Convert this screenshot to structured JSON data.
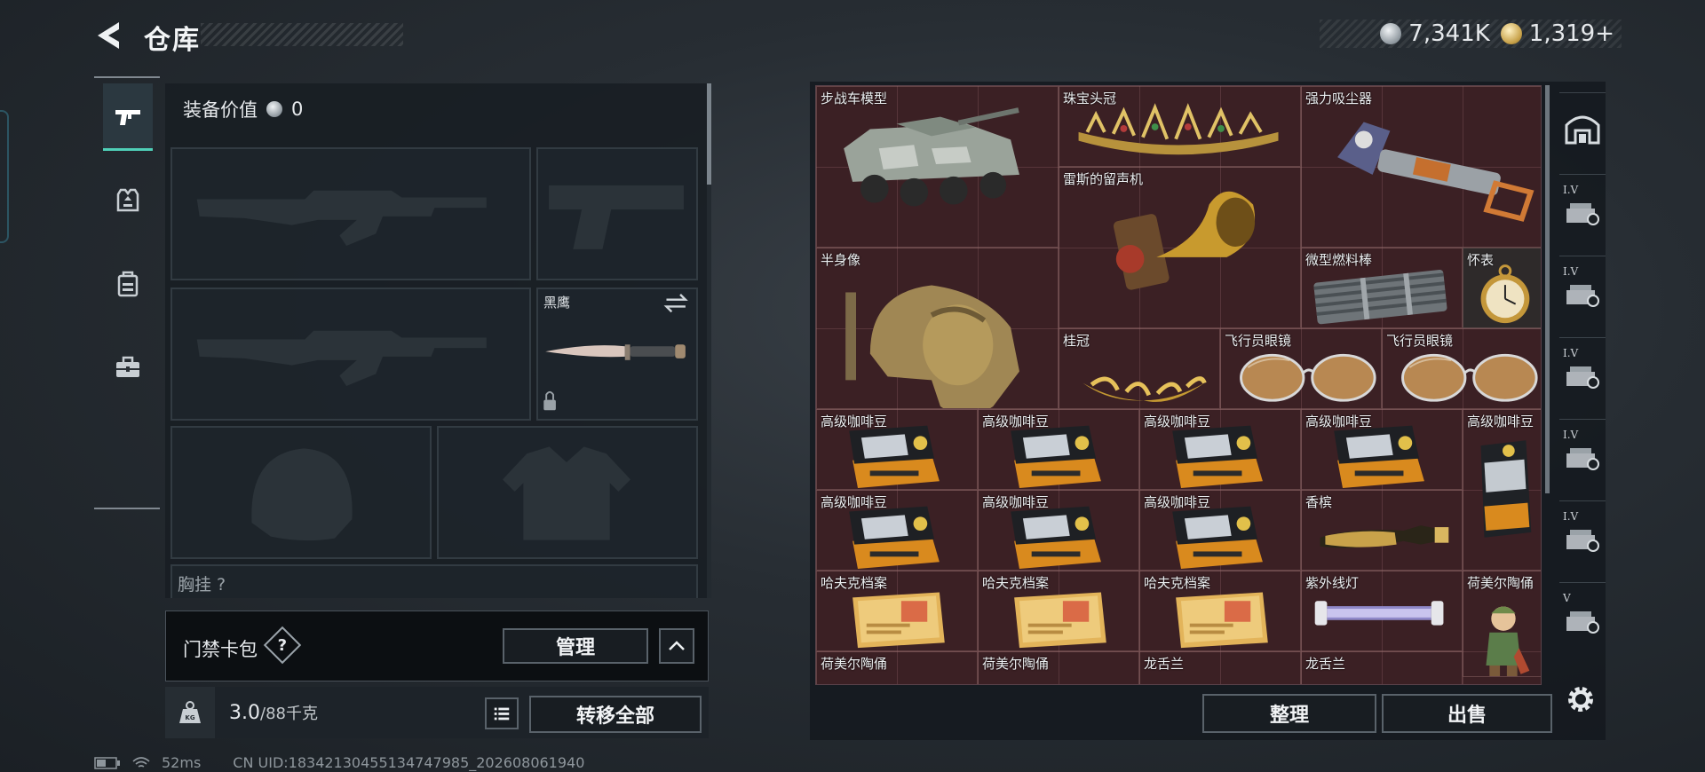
{
  "header": {
    "title": "仓库",
    "currency": [
      {
        "icon": "silver-coin-icon",
        "value": "7,341K"
      },
      {
        "icon": "gold-coin-icon",
        "value": "1,319+"
      }
    ]
  },
  "left_rail": {
    "tabs": [
      {
        "name": "weapons",
        "icon": "pistol-icon",
        "active": true
      },
      {
        "name": "armor",
        "icon": "armor-icon",
        "active": false
      },
      {
        "name": "backpack",
        "icon": "backpack-icon",
        "active": false
      },
      {
        "name": "toolbox",
        "icon": "toolbox-icon",
        "active": false
      }
    ]
  },
  "equipment": {
    "value_label": "装备价值",
    "value": "0",
    "melee_name": "黑鹰",
    "partial_label": "胸挂 ?",
    "slots": [
      "primary-weapon-1",
      "sidearm",
      "primary-weapon-2",
      "melee",
      "helmet",
      "body-armor"
    ]
  },
  "card_pack": {
    "label": "门禁卡包",
    "help": "?",
    "manage_label": "管理"
  },
  "weight": {
    "icon_text": "KG",
    "current": "3.0",
    "max": "/88千克",
    "transfer_label": "转移全部"
  },
  "stash": {
    "items": [
      {
        "name": "步战车模型",
        "img": "ifv"
      },
      {
        "name": "珠宝头冠",
        "img": "tiara"
      },
      {
        "name": "强力吸尘器",
        "img": "vacuum"
      },
      {
        "name": "雷斯的留声机",
        "img": "gramophone"
      },
      {
        "name": "半身像",
        "img": "bust"
      },
      {
        "name": "微型燃料棒",
        "img": "fuelrods"
      },
      {
        "name": "怀表",
        "img": "watch"
      },
      {
        "name": "桂冠",
        "img": "laurel"
      },
      {
        "name": "飞行员眼镜",
        "img": "glasses"
      },
      {
        "name": "飞行员眼镜",
        "img": "glasses"
      },
      {
        "name": "高级咖啡豆",
        "img": "coffee"
      },
      {
        "name": "高级咖啡豆",
        "img": "coffee"
      },
      {
        "name": "高级咖啡豆",
        "img": "coffee"
      },
      {
        "name": "高级咖啡豆",
        "img": "coffee"
      },
      {
        "name": "高级咖啡豆",
        "img": "coffee_tall"
      },
      {
        "name": "高级咖啡豆",
        "img": "coffee"
      },
      {
        "name": "高级咖啡豆",
        "img": "coffee"
      },
      {
        "name": "高级咖啡豆",
        "img": "coffee"
      },
      {
        "name": "香槟",
        "img": "champagne"
      },
      {
        "name": "哈夫克档案",
        "img": "files"
      },
      {
        "name": "哈夫克档案",
        "img": "files"
      },
      {
        "name": "哈夫克档案",
        "img": "files"
      },
      {
        "name": "紫外线灯",
        "img": "uvlamp"
      },
      {
        "name": "荷美尔陶俑",
        "img": "figurine"
      },
      {
        "name": "荷美尔陶俑",
        "img": "figurine_low"
      },
      {
        "name": "荷美尔陶俑",
        "img": "figurine_low"
      },
      {
        "name": "龙舌兰",
        "img": "tequila"
      },
      {
        "name": "龙舌兰",
        "img": "tequila"
      }
    ],
    "sort_label": "整理",
    "sell_label": "出售"
  },
  "right_rail": {
    "tabs": [
      {
        "icon": "stash-home-icon",
        "label": ""
      },
      {
        "icon": "storage-1-icon",
        "label": "I.V"
      },
      {
        "icon": "storage-2-icon",
        "label": "I.V"
      },
      {
        "icon": "storage-3-icon",
        "label": "I.V"
      },
      {
        "icon": "storage-4-icon",
        "label": "I.V"
      },
      {
        "icon": "storage-5-icon",
        "label": "I.V"
      },
      {
        "icon": "storage-6-icon",
        "label": "V"
      }
    ]
  },
  "status": {
    "ping": "52ms",
    "uid": "CN UID:18342130455134747985_202608061940"
  },
  "colors": {
    "accent": "#4fd0b8",
    "stash_bg": "#3b2024",
    "panel_bg": "#181e23"
  }
}
